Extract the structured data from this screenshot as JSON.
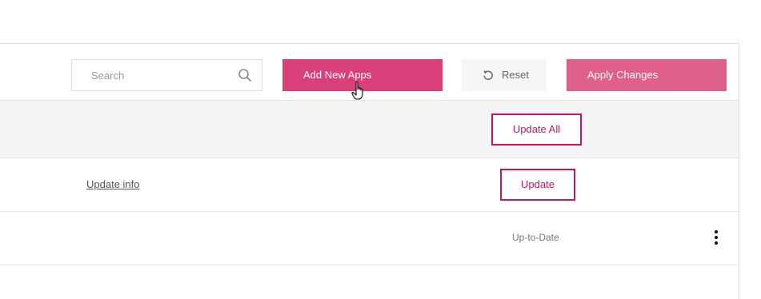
{
  "toolbar": {
    "search_placeholder": "Search",
    "search_value": "",
    "add_button_label": "Add New Apps",
    "reset_label": "Reset",
    "apply_label": "Apply Changes"
  },
  "header_row": {
    "update_all_label": "Update All"
  },
  "rows": [
    {
      "link_label": "Update info",
      "action_label": "Update"
    },
    {
      "status": "Up-to-Date",
      "menu_icon": "more-vertical-icon"
    }
  ],
  "colors": {
    "primary": "#d9407a",
    "apply": "#e0608c",
    "outline": "#c2185b"
  }
}
